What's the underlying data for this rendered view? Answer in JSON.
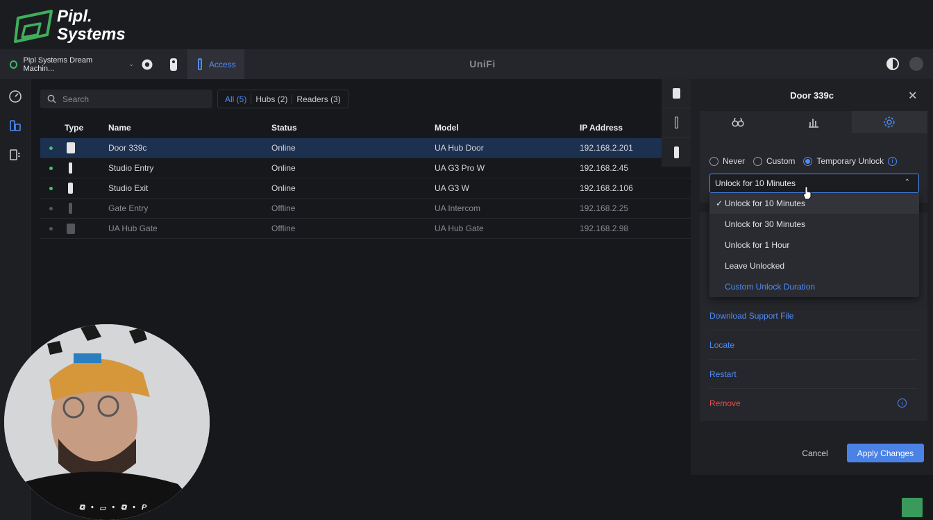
{
  "brand": {
    "line1": "Pipl.",
    "line2": "Systems",
    "accent": "#3fae5c"
  },
  "topbar": {
    "site_name": "Pipl Systems Dream Machin...",
    "app_name": "Access",
    "title": "UniFi"
  },
  "search": {
    "placeholder": "Search"
  },
  "filters": [
    {
      "label": "All (5)",
      "active": true
    },
    {
      "label": "Hubs (2)",
      "active": false
    },
    {
      "label": "Readers (3)",
      "active": false
    }
  ],
  "table": {
    "columns": {
      "type": "Type",
      "name": "Name",
      "status": "Status",
      "model": "Model",
      "ip": "IP Address"
    },
    "rows": [
      {
        "name": "Door 339c",
        "status": "Online",
        "model": "UA Hub Door",
        "ip": "192.168.2.201",
        "selected": true,
        "online": true,
        "icon": "hub-door-icon"
      },
      {
        "name": "Studio Entry",
        "status": "Online",
        "model": "UA G3 Pro W",
        "ip": "192.168.2.45",
        "selected": false,
        "online": true,
        "icon": "reader-icon"
      },
      {
        "name": "Studio Exit",
        "status": "Online",
        "model": "UA G3 W",
        "ip": "192.168.2.106",
        "selected": false,
        "online": true,
        "icon": "reader-icon"
      },
      {
        "name": "Gate Entry",
        "status": "Offline",
        "model": "UA Intercom",
        "ip": "192.168.2.25",
        "selected": false,
        "online": false,
        "icon": "intercom-icon"
      },
      {
        "name": "UA Hub Gate",
        "status": "Offline",
        "model": "UA Hub Gate",
        "ip": "192.168.2.98",
        "selected": false,
        "online": false,
        "icon": "hub-gate-icon"
      }
    ]
  },
  "panel": {
    "title": "Door 339c",
    "radio": {
      "never": "Never",
      "custom": "Custom",
      "temporary": "Temporary Unlock",
      "selected": "temporary"
    },
    "duration_value": "Unlock for 10 Minutes",
    "menu": [
      {
        "label": "Unlock for 10 Minutes",
        "checked": true
      },
      {
        "label": "Unlock for 30 Minutes",
        "checked": false
      },
      {
        "label": "Unlock for 1 Hour",
        "checked": false
      },
      {
        "label": "Leave Unlocked",
        "checked": false
      },
      {
        "label": "Custom Unlock Duration",
        "checked": false,
        "link": true
      }
    ],
    "check_mark": "✓",
    "actions": {
      "download": "Download Support File",
      "locate": "Locate",
      "restart": "Restart",
      "remove": "Remove"
    },
    "cancel": "Cancel",
    "apply": "Apply Changes"
  },
  "webcam": {
    "watermark": "P"
  },
  "colors": {
    "accent": "#4f8bf6",
    "online": "#43c26f",
    "danger": "#e5504a",
    "selected_row": "#1c3050"
  }
}
